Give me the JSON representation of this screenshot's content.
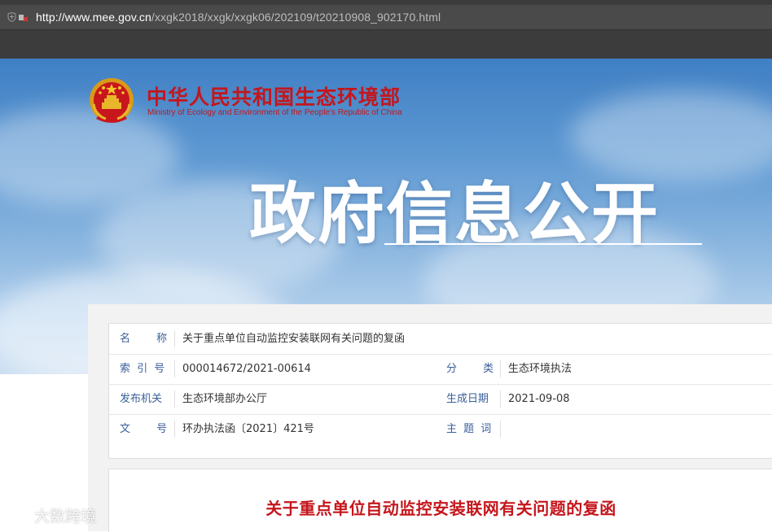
{
  "browser": {
    "url_domain": "http://www.mee.gov.cn",
    "url_path": "/xxgk2018/xxgk/xxgk06/202109/t20210908_902170.html"
  },
  "header": {
    "ministry_cn": "中华人民共和国生态环境部",
    "ministry_en": "Ministry of Ecology and Environment of the People's Republic of China",
    "headline": "政府信息公开"
  },
  "meta": {
    "name_label": "名 称",
    "name_value": "关于重点单位自动监控安装联网有关问题的复函",
    "index_label": "索 引 号",
    "index_value": "000014672/2021-00614",
    "category_label": "分 类",
    "category_value": "生态环境执法",
    "issuer_label": "发布机关",
    "issuer_value": "生态环境部办公厅",
    "date_label": "生成日期",
    "date_value": "2021-09-08",
    "docno_label": "文 号",
    "docno_value": "环办执法函〔2021〕421号",
    "subject_label": "主 题 词",
    "subject_value": ""
  },
  "document": {
    "title": "关于重点单位自动监控安装联网有关问题的复函"
  },
  "watermark": {
    "text": "大数跨境"
  },
  "colors": {
    "brand_red": "#c4161c",
    "label_blue": "#3a5f9a"
  }
}
